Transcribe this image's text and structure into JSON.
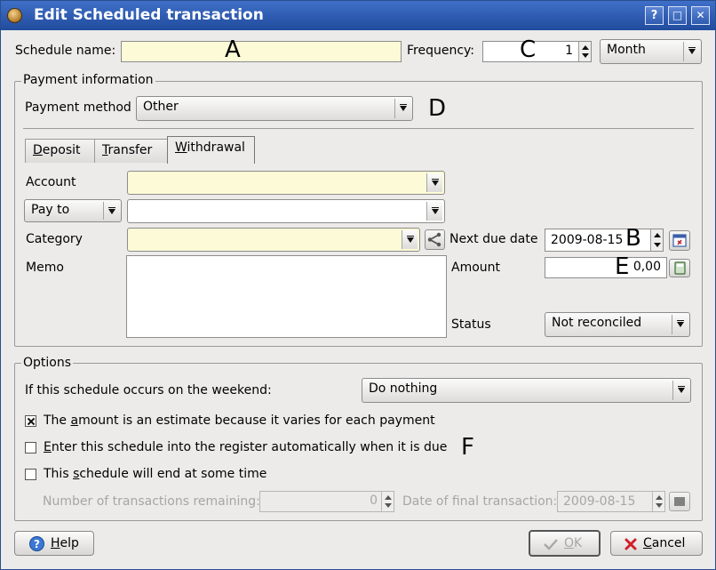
{
  "window": {
    "title": "Edit Scheduled transaction",
    "help_btn": "?",
    "max_btn": "□",
    "close_btn": "✕"
  },
  "markers": {
    "a": "A",
    "b": "B",
    "c": "C",
    "d": "D",
    "e": "E",
    "f": "F"
  },
  "schedule": {
    "name_label": "Schedule name:",
    "name_value": "",
    "frequency_label": "Frequency:",
    "frequency_count": "1",
    "frequency_unit": "Month"
  },
  "payment": {
    "group_title": "Payment information",
    "method_label": "Payment method",
    "method_value": "Other",
    "tabs": [
      {
        "pre": "",
        "u": "D",
        "post": "eposit"
      },
      {
        "pre": "",
        "u": "T",
        "post": "ransfer"
      },
      {
        "pre": "",
        "u": "W",
        "post": "ithdrawal"
      }
    ],
    "account_label": "Account",
    "account_value": "",
    "payto_value": "Pay to",
    "payee_value": "",
    "category_label": "Category",
    "category_value": "",
    "memo_label": "Memo",
    "memo_value": "",
    "next_due_label": "Next due date",
    "next_due_value": "2009-08-15",
    "amount_label": "Amount",
    "amount_value": "0,00",
    "status_label": "Status",
    "status_value": "Not reconciled"
  },
  "options": {
    "group_title": "Options",
    "weekend_label": "If this schedule occurs on the weekend:",
    "weekend_value": "Do nothing",
    "estimate": {
      "pre": "The ",
      "u": "a",
      "post": "mount is an estimate because it varies for each payment",
      "checked": true
    },
    "auto_enter": {
      "pre": "",
      "u": "E",
      "post": "nter this schedule into the register automatically when it is due",
      "checked": false
    },
    "end": {
      "pre": "This ",
      "u": "s",
      "post": "chedule will end at some time",
      "checked": false
    },
    "remaining_label": "Number of transactions remaining:",
    "remaining_value": "0",
    "final_date_label": "Date of final transaction:",
    "final_date_value": "2009-08-15"
  },
  "buttons": {
    "help": {
      "pre": "",
      "u": "H",
      "post": "elp"
    },
    "ok": {
      "pre": "",
      "u": "O",
      "post": "K"
    },
    "cancel": {
      "pre": "",
      "u": "C",
      "post": "ancel"
    }
  },
  "colors": {
    "title_bar": "#214c9e",
    "required_field": "#fdfbd7",
    "dialog_bg": "#ecebe9"
  }
}
